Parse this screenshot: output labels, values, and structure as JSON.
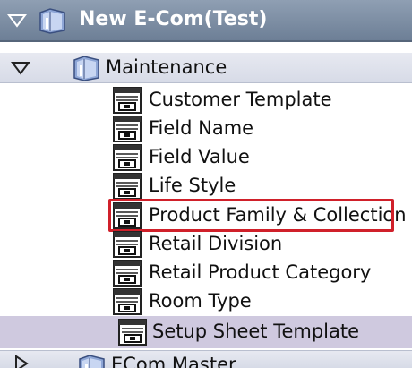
{
  "tree": {
    "root": {
      "label": "New E-Com(Test)",
      "icon": "folder-icon",
      "expanded": true
    },
    "group": {
      "label": "Maintenance",
      "icon": "folder-icon",
      "expanded": true
    },
    "items": [
      {
        "label": "Customer Template",
        "icon": "form-icon"
      },
      {
        "label": "Field Name",
        "icon": "form-icon"
      },
      {
        "label": "Field Value",
        "icon": "form-icon"
      },
      {
        "label": "Life Style",
        "icon": "form-icon"
      },
      {
        "label": "Product Family & Collection",
        "icon": "form-icon",
        "highlighted": true
      },
      {
        "label": "Retail Division",
        "icon": "form-icon"
      },
      {
        "label": "Retail Product Category",
        "icon": "form-icon"
      },
      {
        "label": "Room Type",
        "icon": "form-icon"
      },
      {
        "label": "Setup Sheet Template",
        "icon": "form-icon",
        "selected": true
      }
    ],
    "next_group": {
      "label": "ECom Master",
      "icon": "folder-icon",
      "expanded": false
    }
  },
  "colors": {
    "header_bg": "#7a8ba2",
    "selected_bg": "#cfc9df",
    "highlight_border": "#d0202a"
  }
}
